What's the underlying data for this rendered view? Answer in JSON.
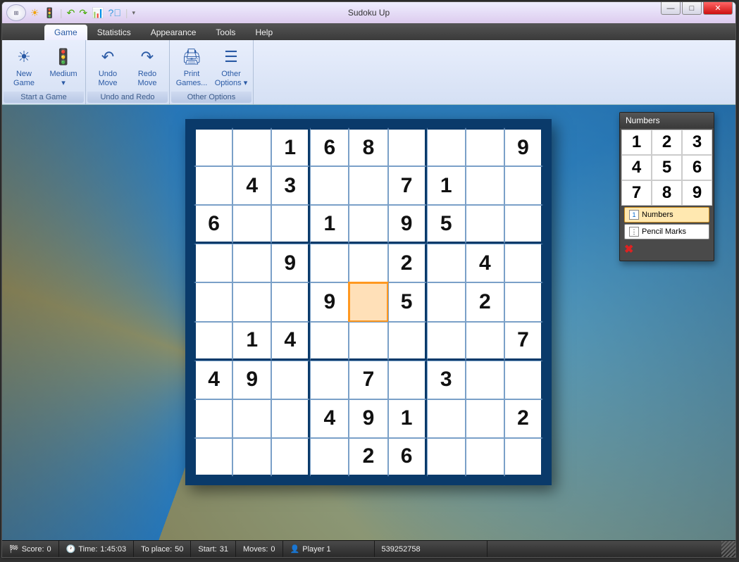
{
  "title": "Sudoku Up",
  "tabs": [
    "Game",
    "Statistics",
    "Appearance",
    "Tools",
    "Help"
  ],
  "active_tab": 0,
  "ribbon": {
    "groups": [
      {
        "title": "Start a Game",
        "items": [
          {
            "l1": "New",
            "l2": "Game",
            "icon": "☀"
          },
          {
            "l1": "Medium",
            "l2": "▾",
            "icon": "🚦"
          }
        ]
      },
      {
        "title": "Undo and Redo",
        "items": [
          {
            "l1": "Undo",
            "l2": "Move",
            "icon": "↶"
          },
          {
            "l1": "Redo",
            "l2": "Move",
            "icon": "↷"
          }
        ]
      },
      {
        "title": "Other Options",
        "items": [
          {
            "l1": "Print",
            "l2": "Games...",
            "icon": "🖨"
          },
          {
            "l1": "Other",
            "l2": "Options ▾",
            "icon": "☰"
          }
        ]
      }
    ]
  },
  "numpad": {
    "title": "Numbers",
    "numbers": [
      "1",
      "2",
      "3",
      "4",
      "5",
      "6",
      "7",
      "8",
      "9"
    ],
    "mode_numbers": "Numbers",
    "mode_pencil": "Pencil Marks"
  },
  "grid": [
    [
      "",
      "",
      "1",
      "6",
      "8",
      "",
      "",
      "",
      "9"
    ],
    [
      "",
      "4",
      "3",
      "",
      "",
      "7",
      "1",
      "",
      ""
    ],
    [
      "6",
      "",
      "",
      "1",
      "",
      "9",
      "5",
      "",
      ""
    ],
    [
      "",
      "",
      "9",
      "",
      "",
      "2",
      "",
      "4",
      ""
    ],
    [
      "",
      "",
      "",
      "9",
      "",
      "5",
      "",
      "2",
      ""
    ],
    [
      "",
      "1",
      "4",
      "",
      "",
      "",
      "",
      "",
      "7"
    ],
    [
      "4",
      "9",
      "",
      "",
      "7",
      "",
      "3",
      "",
      ""
    ],
    [
      "",
      "",
      "",
      "4",
      "9",
      "1",
      "",
      "",
      "2"
    ],
    [
      "",
      "",
      "",
      "",
      "2",
      "6",
      "",
      "",
      ""
    ]
  ],
  "selected": {
    "row": 4,
    "col": 4
  },
  "status": {
    "score_label": "Score:",
    "score": "0",
    "time_label": "Time:",
    "time": "1:45:03",
    "toplace_label": "To place:",
    "toplace": "50",
    "start_label": "Start:",
    "start": "31",
    "moves_label": "Moves:",
    "moves": "0",
    "player_label": "Player 1",
    "seed": "539252758"
  }
}
